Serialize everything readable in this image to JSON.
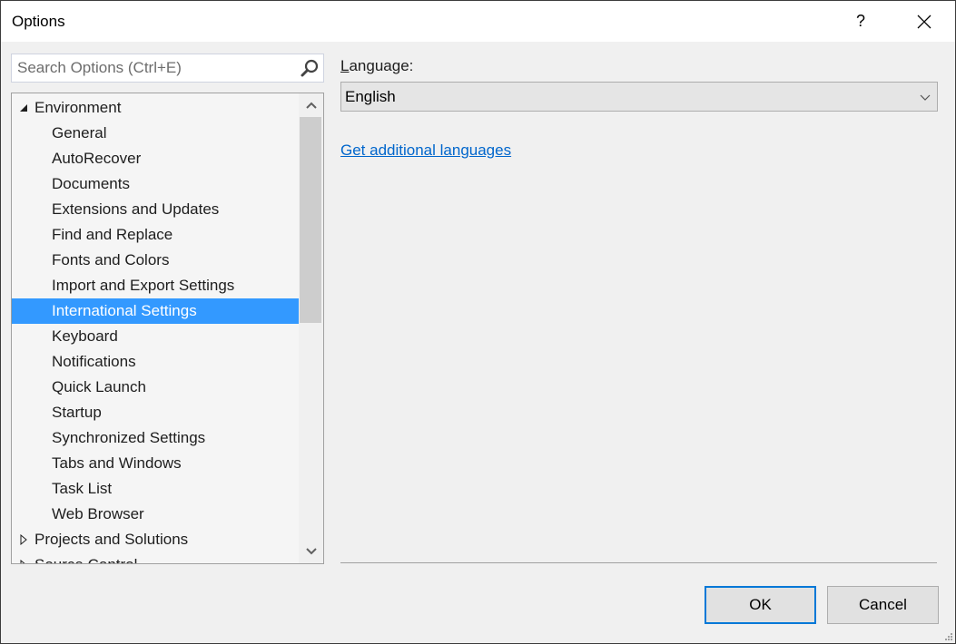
{
  "window": {
    "title": "Options",
    "help_label": "?",
    "close_label": "close"
  },
  "search": {
    "placeholder": "Search Options (Ctrl+E)",
    "value": ""
  },
  "tree": {
    "items": [
      {
        "label": "Environment",
        "level": 0,
        "expander": "expanded"
      },
      {
        "label": "General",
        "level": 1
      },
      {
        "label": "AutoRecover",
        "level": 1
      },
      {
        "label": "Documents",
        "level": 1
      },
      {
        "label": "Extensions and Updates",
        "level": 1
      },
      {
        "label": "Find and Replace",
        "level": 1
      },
      {
        "label": "Fonts and Colors",
        "level": 1
      },
      {
        "label": "Import and Export Settings",
        "level": 1
      },
      {
        "label": "International Settings",
        "level": 1,
        "selected": true
      },
      {
        "label": "Keyboard",
        "level": 1
      },
      {
        "label": "Notifications",
        "level": 1
      },
      {
        "label": "Quick Launch",
        "level": 1
      },
      {
        "label": "Startup",
        "level": 1
      },
      {
        "label": "Synchronized Settings",
        "level": 1
      },
      {
        "label": "Tabs and Windows",
        "level": 1
      },
      {
        "label": "Task List",
        "level": 1
      },
      {
        "label": "Web Browser",
        "level": 1
      },
      {
        "label": "Projects and Solutions",
        "level": 0,
        "expander": "collapsed"
      },
      {
        "label": "Source Control",
        "level": 0,
        "expander": "collapsed"
      }
    ]
  },
  "settings": {
    "language_label": "Language:",
    "language_access_key": "L",
    "language_rest": "anguage:",
    "language_value": "English",
    "additional_languages_link": "Get additional languages"
  },
  "footer": {
    "ok_label": "OK",
    "cancel_label": "Cancel"
  },
  "colors": {
    "selection": "#3399ff",
    "link": "#0066cc",
    "default_button_border": "#0078d7"
  }
}
